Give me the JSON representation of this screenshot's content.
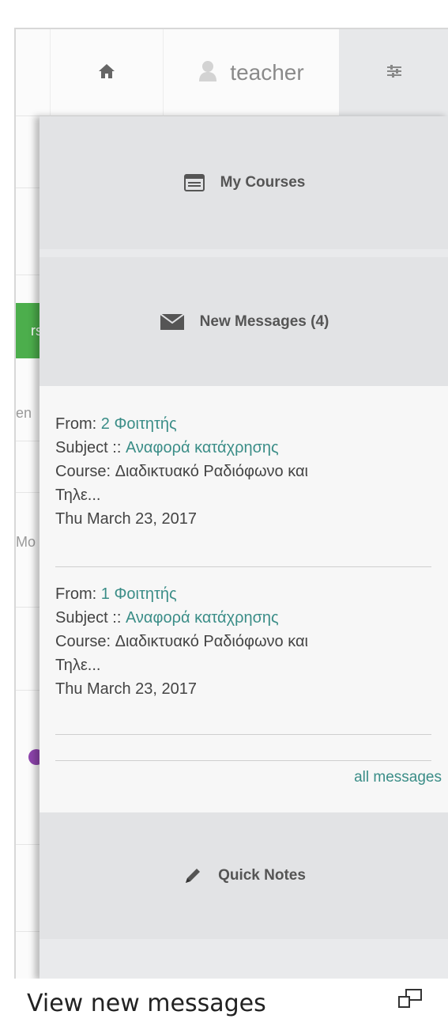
{
  "topbar": {
    "home_icon": "home-icon",
    "user_label": "teacher",
    "user_icon": "user-icon",
    "settings_icon": "sliders-icon"
  },
  "background_page": {
    "green_tab_text": "rs",
    "fragments": [
      "en",
      "Mo"
    ]
  },
  "panel": {
    "my_courses": {
      "label": "My Courses",
      "icon": "course-window-icon"
    },
    "new_messages": {
      "label": "New Messages (4)",
      "icon": "envelope-icon"
    },
    "messages": [
      {
        "from_label": "From:",
        "from": "2 Φοιτητής",
        "subject_label": "Subject ::",
        "subject": "Αναφορά κατάχρησης",
        "course_label": "Course:",
        "course": "Διαδικτυακό Ραδιόφωνο και",
        "course_cont": "Τηλε...",
        "date": "Thu March 23, 2017"
      },
      {
        "from_label": "From:",
        "from": "1 Φοιτητής",
        "subject_label": "Subject ::",
        "subject": "Αναφορά κατάχρησης",
        "course_label": "Course:",
        "course": "Διαδικτυακό Ραδιόφωνο και",
        "course_cont": "Τηλε...",
        "date": "Thu March 23, 2017"
      }
    ],
    "all_messages": "all messages",
    "quick_notes": {
      "label": "Quick Notes",
      "icon": "pencil-icon"
    }
  },
  "caption": {
    "text": "View new messages",
    "icon": "screens-icon"
  },
  "colors": {
    "link": "#3a8d87",
    "panel_bg": "#e9eaec",
    "green": "#4cae4c"
  }
}
